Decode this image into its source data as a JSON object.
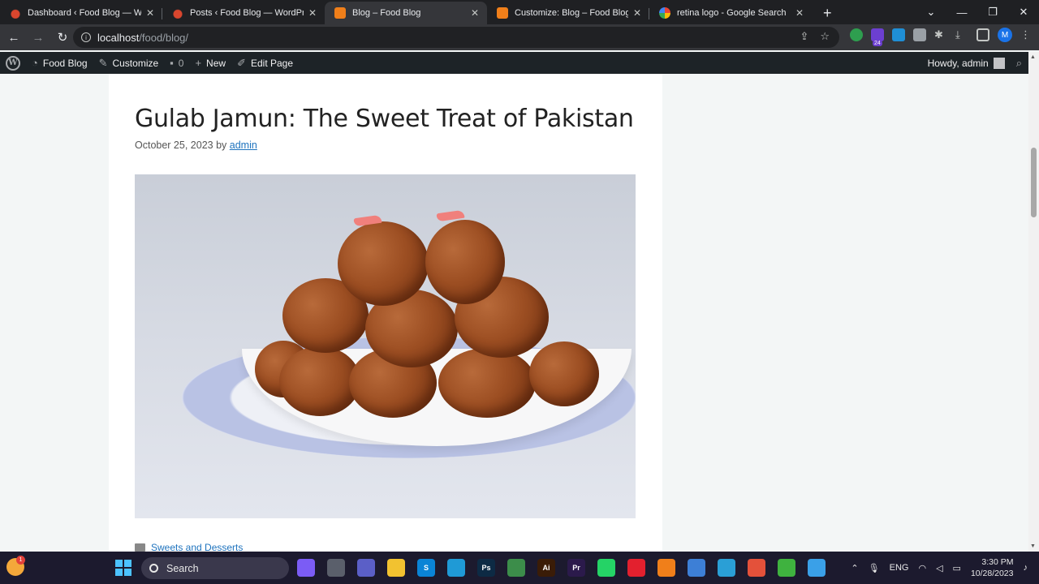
{
  "browser": {
    "tabs": [
      {
        "title": "Dashboard ‹ Food Blog — WordPress",
        "favicon": "wordpress",
        "active": false
      },
      {
        "title": "Posts ‹ Food Blog — WordPress",
        "favicon": "wordpress",
        "active": false
      },
      {
        "title": "Blog – Food Blog",
        "favicon": "xampp",
        "active": true
      },
      {
        "title": "Customize: Blog – Food Blog",
        "favicon": "xampp",
        "active": false
      },
      {
        "title": "retina logo - Google Search",
        "favicon": "google",
        "active": false
      }
    ],
    "close_glyph": "✕",
    "new_tab_glyph": "+",
    "url_host": "localhost",
    "url_path": "/food/blog/",
    "profile_initial": "M",
    "extension_badge": "24"
  },
  "adminbar": {
    "site_name": "Food Blog",
    "customize": "Customize",
    "comments_count": "0",
    "new": "New",
    "edit_page": "Edit Page",
    "howdy": "Howdy, admin"
  },
  "post": {
    "title": "Gulab Jamun: The Sweet Treat of Pakistan",
    "date": "October 25, 2023",
    "by": "by",
    "author": "admin",
    "category": "Sweets and Desserts"
  },
  "taskbar": {
    "search_placeholder": "Search",
    "weather_badge": "1",
    "language": "ENG",
    "time": "3:30 PM",
    "date": "10/28/2023",
    "apps": [
      {
        "name": "copilot",
        "label": "",
        "color": "#7b5cf5"
      },
      {
        "name": "task-view",
        "label": "",
        "color": "#5a5f6b"
      },
      {
        "name": "teams",
        "label": "",
        "color": "#5b5fc7"
      },
      {
        "name": "file-explorer",
        "label": "",
        "color": "#f2c230"
      },
      {
        "name": "skype",
        "label": "S",
        "color": "#0a84d6"
      },
      {
        "name": "edge",
        "label": "",
        "color": "#1f9ad6"
      },
      {
        "name": "photoshop",
        "label": "Ps",
        "color": "#0d2a44"
      },
      {
        "name": "chrome",
        "label": "",
        "color": "#3c8d4a"
      },
      {
        "name": "illustrator",
        "label": "Ai",
        "color": "#3a1c07"
      },
      {
        "name": "premiere",
        "label": "Pr",
        "color": "#2b1a4b"
      },
      {
        "name": "whatsapp",
        "label": "",
        "color": "#25d366"
      },
      {
        "name": "opera",
        "label": "",
        "color": "#e3202e"
      },
      {
        "name": "xampp",
        "label": "",
        "color": "#f07f1a"
      },
      {
        "name": "notepad",
        "label": "",
        "color": "#3d7fd6"
      },
      {
        "name": "remote",
        "label": "",
        "color": "#2a9fd6"
      },
      {
        "name": "app-red",
        "label": "",
        "color": "#e4513a"
      },
      {
        "name": "app-green",
        "label": "",
        "color": "#3fb23f"
      },
      {
        "name": "paint",
        "label": "",
        "color": "#3aa0e8"
      }
    ]
  }
}
